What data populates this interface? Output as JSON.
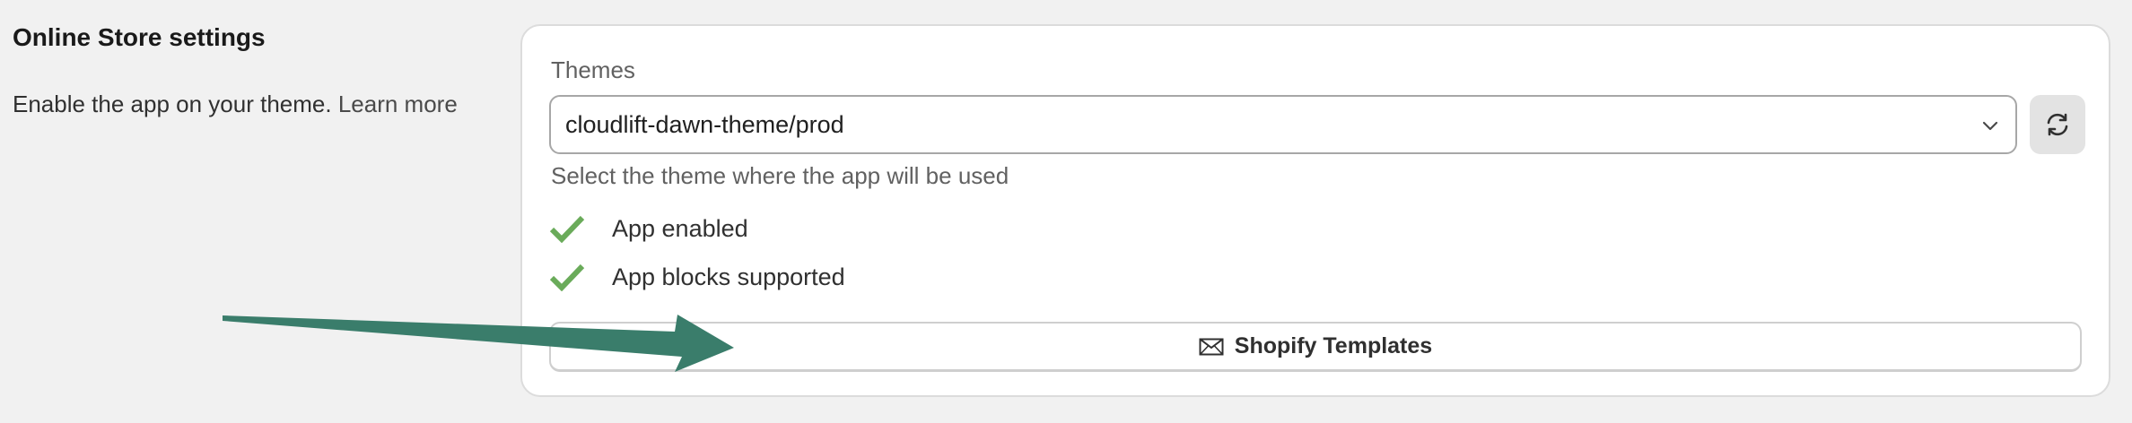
{
  "section": {
    "title": "Online Store settings",
    "description": "Enable the app on your theme.",
    "learn_more": "Learn more"
  },
  "themes": {
    "label": "Themes",
    "selected": "cloudlift-dawn-theme/prod",
    "help": "Select the theme where the app will be used"
  },
  "status": [
    {
      "label": "App enabled",
      "ok": true
    },
    {
      "label": "App blocks supported",
      "ok": true
    }
  ],
  "templates_button": {
    "label": "Shopify Templates"
  },
  "icons": {
    "chevron": "chevron-down-icon",
    "refresh": "refresh-icon",
    "check": "checkmark-icon",
    "mail": "mail-icon"
  },
  "colors": {
    "check": "#6aab5a",
    "arrow": "#3a7d6b",
    "background": "#f1f1f1"
  }
}
